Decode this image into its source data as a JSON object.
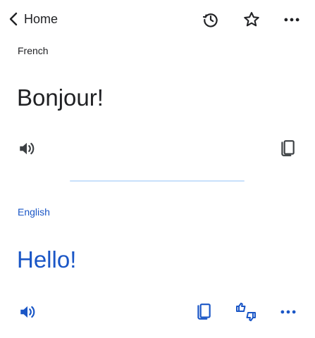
{
  "header": {
    "back_label": "Home",
    "icons": {
      "back": "chevron-left-icon",
      "history": "history-icon",
      "favorite": "star-icon",
      "menu": "more-horiz-icon"
    }
  },
  "source": {
    "language": "French",
    "text": "Bonjour!",
    "icons": [
      "speaker-icon",
      "copy-icon"
    ]
  },
  "target": {
    "language": "English",
    "text": "Hello!",
    "icons": [
      "speaker-icon",
      "copy-icon",
      "feedback-thumbs-icon",
      "more-horiz-icon"
    ]
  },
  "colors": {
    "text": "#202124",
    "accent": "#1a56c6",
    "icon_gray": "#3c4043",
    "divider": "#c8e0fb"
  }
}
